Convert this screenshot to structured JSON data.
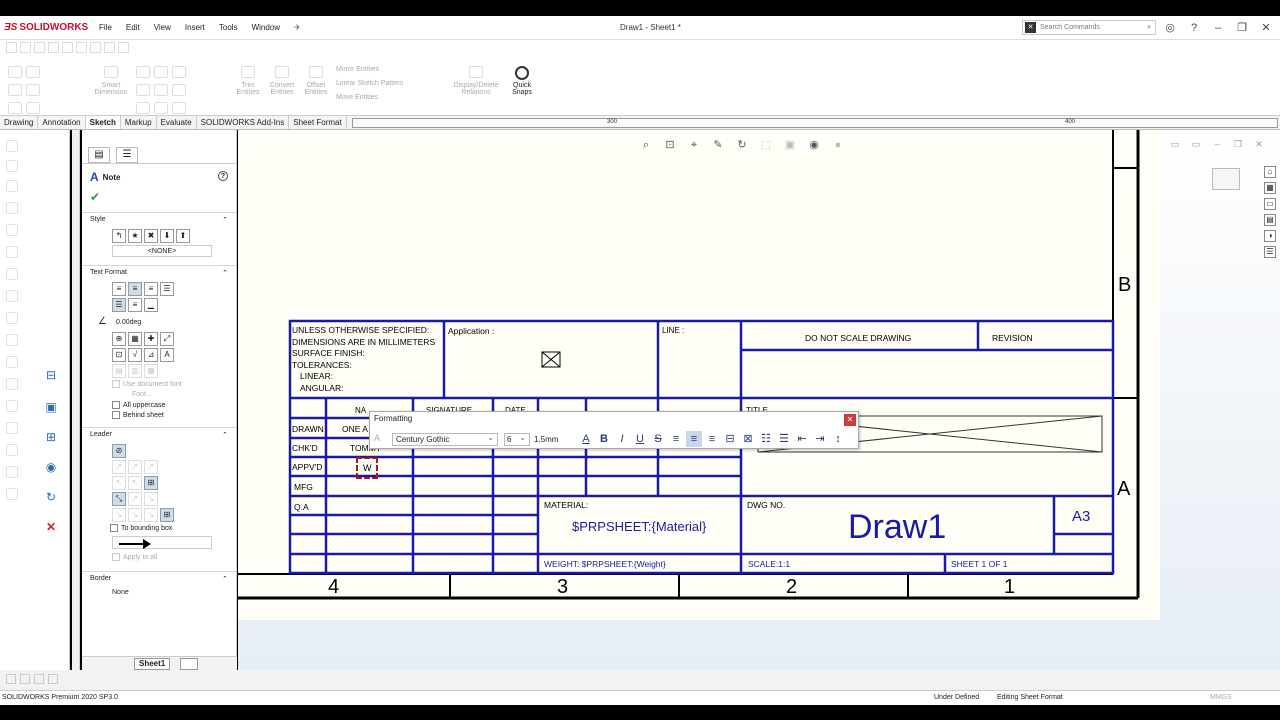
{
  "app": {
    "brand": "SOLIDWORKS",
    "menu": [
      "File",
      "Edit",
      "View",
      "Insert",
      "Tools",
      "Window"
    ],
    "doc_title": "Draw1 - Sheet1 *",
    "search_placeholder": "Search Commands"
  },
  "ribbon": {
    "groups": [
      {
        "label": "Smart\nDimension"
      },
      {
        "label": "Trim\nEntities"
      },
      {
        "label": "Convert\nEntities"
      },
      {
        "label": "Offset\nEntities"
      },
      {
        "label": "Mirror Entities"
      },
      {
        "label": "Linear Sketch Pattern"
      },
      {
        "label": "Move Entities"
      },
      {
        "label": "Display/Delete\nRelations"
      }
    ],
    "quick_snaps": "Quick\nSnaps"
  },
  "tabs": [
    "Drawing",
    "Annotation",
    "Sketch",
    "Markup",
    "Evaluate",
    "SOLIDWORKS Add-Ins",
    "Sheet Format"
  ],
  "active_tab": "Sketch",
  "ruler_marks": [
    "300",
    "400"
  ],
  "property_manager": {
    "title": "Note",
    "style": {
      "header": "Style",
      "value": "<NONE>"
    },
    "text_format": {
      "header": "Text Format",
      "angle": "0.00deg",
      "use_doc_font": "Use document font",
      "font_btn": "Font...",
      "all_upper": "All uppercase",
      "behind_sheet": "Behind sheet"
    },
    "leader": {
      "header": "Leader",
      "to_bounding_box": "To bounding box",
      "apply_all": "Apply to all"
    },
    "border": {
      "header": "Border",
      "value": "None"
    }
  },
  "sheet_tab": "Sheet1",
  "title_block": {
    "tolerance_lines": [
      "UNLESS OTHERWISE SPECIFIED:",
      "DIMENSIONS ARE IN MILLIMETERS",
      "SURFACE FINISH:",
      "TOLERANCES:",
      "LINEAR:",
      "ANGULAR:"
    ],
    "application": "Application :",
    "line": "LINE :",
    "do_not_scale": "DO NOT SCALE DRAWING",
    "revision": "REVISION",
    "col_headers": [
      "NA",
      "SIGNATURE",
      "DATE"
    ],
    "title_label": "TITLE",
    "rows": [
      "DRAWN",
      "CHK'D",
      "APPV'D",
      "MFG",
      "Q.A"
    ],
    "drawn_name": "ONE A",
    "chkd_name": "TOMMY",
    "material_label": "MATERIAL:",
    "material_value": "$PRPSHEET:{Material}",
    "dwg_no_label": "DWG NO.",
    "dwg_no_value": "Draw1",
    "size": "A3",
    "weight": "WEIGHT: $PRPSHEET:{Weight}",
    "scale": "SCALE:1:1",
    "sheet_of": "SHEET 1 OF 1",
    "zones_bottom": [
      "4",
      "3",
      "2",
      "1"
    ],
    "zones_right": [
      "B",
      "A"
    ]
  },
  "formatting": {
    "title": "Formatting",
    "font": "Century Gothic",
    "size": "6",
    "height": "1.5mm"
  },
  "edit_text": "W",
  "status": {
    "app_version": "SOLIDWORKS Premium 2020 SP3.0",
    "state": "Under Defined",
    "mode": "Editing Sheet Format",
    "units": "MMGS"
  }
}
